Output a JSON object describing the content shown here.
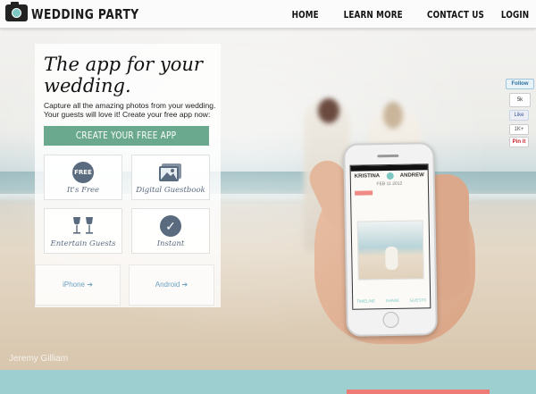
{
  "header": {
    "brand": "WEDDING PARTY",
    "nav": [
      "HOME",
      "LEARN MORE",
      "CONTACT US",
      "LOGIN"
    ]
  },
  "hero": {
    "headline": "The app for your wedding.",
    "subtext": "Capture all the amazing photos from your wedding. Your guests will love it! Create your free app now:",
    "cta_label": "CREATE YOUR FREE APP",
    "features": [
      {
        "label": "It's Free",
        "icon": "free-badge-icon",
        "badge_text": "FREE"
      },
      {
        "label": "Digital Guestbook",
        "icon": "photo-album-icon"
      },
      {
        "label": "Entertain Guests",
        "icon": "wine-glasses-icon"
      },
      {
        "label": "Instant",
        "icon": "checkmark-icon",
        "badge_text": "✓"
      }
    ],
    "stores": [
      "iPhone ➔",
      "Android ➔"
    ],
    "photo_credit": "Jeremy Gilliam"
  },
  "phone": {
    "name_left": "KRISTINA",
    "name_right": "ANDREW",
    "date": "FEB 11 2012",
    "tabs": [
      "TIMELINE",
      "SHARE",
      "GUESTS"
    ]
  },
  "social": {
    "twitter": "Follow",
    "like_count": "5k",
    "facebook": "Like",
    "plus_count": "1K+",
    "pinterest": "Pin it"
  },
  "colors": {
    "accent_green": "#6aa98d",
    "teal": "#9ecfd0",
    "coral": "#ef7b77",
    "icon_slate": "#5a6b80"
  }
}
